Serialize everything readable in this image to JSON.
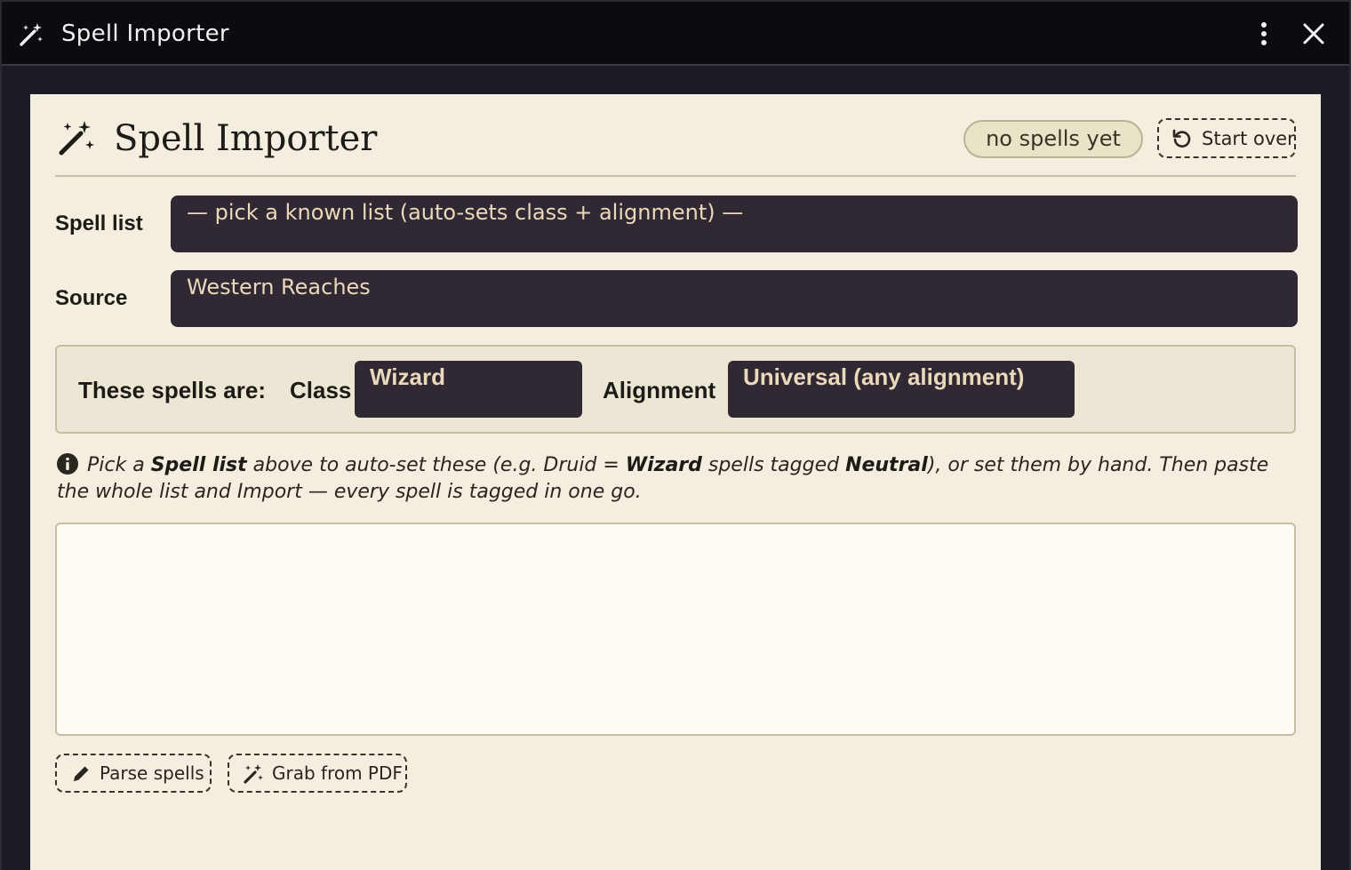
{
  "window": {
    "title": "Spell Importer",
    "icon": "magic-wand-icon"
  },
  "header": {
    "title": "Spell Importer",
    "icon": "magic-wand-icon",
    "status_pill": "no spells yet",
    "start_over_label": "Start over"
  },
  "form": {
    "spell_list_label": "Spell list",
    "spell_list_value": "— pick a known list (auto-sets class + alignment) —",
    "source_label": "Source",
    "source_value": "Western Reaches"
  },
  "tagging": {
    "lead": "These spells are:",
    "class_label": "Class",
    "class_value": "Wizard",
    "alignment_label": "Alignment",
    "alignment_value": "Universal (any alignment)"
  },
  "info": {
    "p1": "Pick a ",
    "b1": "Spell list",
    "p2": " above to auto-set these (e.g. Druid = ",
    "b2": "Wizard",
    "p3": " spells tagged ",
    "b3": "Neutral",
    "p4": "), or set them by hand. Then paste the whole list and Import — every spell is tagged in one go."
  },
  "paste_area": {
    "value": "",
    "placeholder": ""
  },
  "actions": {
    "parse_label": "Parse spells",
    "grab_label": "Grab from PDF"
  },
  "colors": {
    "titlebar_bg": "#0b0b10",
    "panel_bg": "#f3eedf",
    "field_bg": "#302832",
    "field_text": "#ead9ba"
  }
}
